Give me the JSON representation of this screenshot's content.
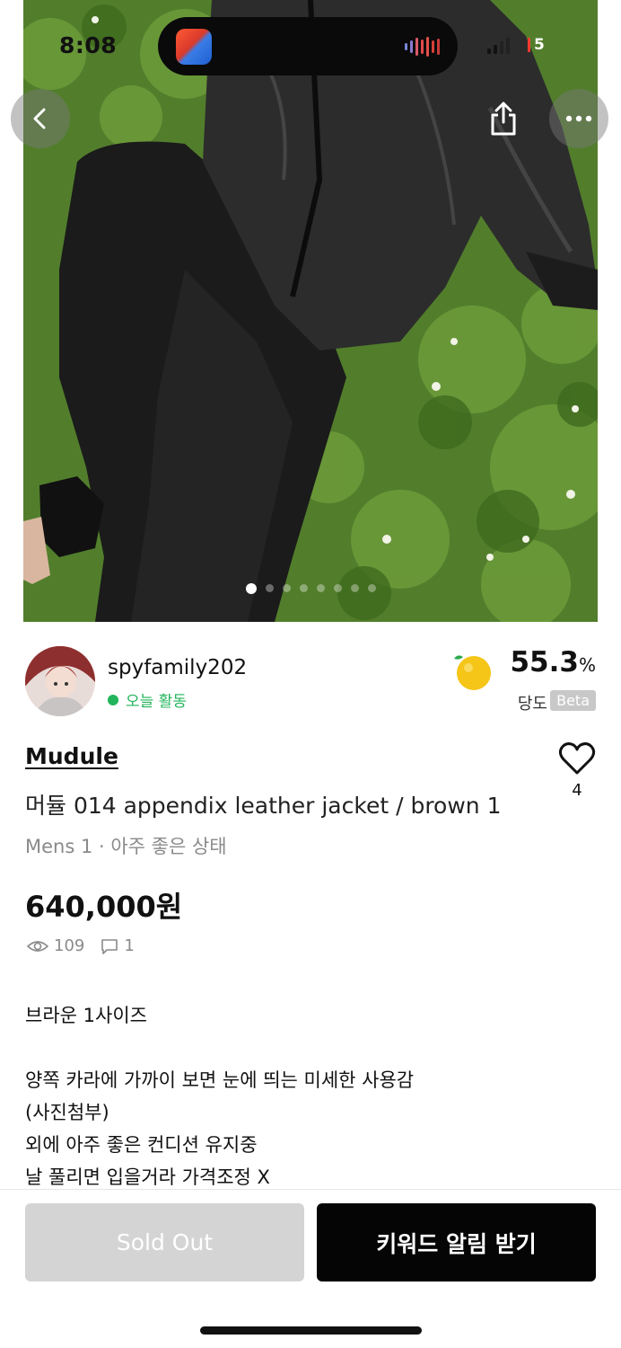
{
  "status_bar": {
    "time": "8:08",
    "battery": "5"
  },
  "nav": {
    "back_icon": "chevron-left-icon",
    "share_icon": "share-icon",
    "more_icon": "more-horizontal-icon"
  },
  "gallery": {
    "image_count": 8,
    "current_index": 1
  },
  "seller": {
    "username": "spyfamily202",
    "activity": "오늘 활동",
    "sweetness_value": "55.3",
    "sweetness_unit": "%",
    "sweetness_label": "당도",
    "beta_badge": "Beta"
  },
  "item": {
    "brand": "Mudule",
    "title": "머듈 014 appendix leather jacket / brown 1",
    "meta": "Mens 1 · 아주 좋은 상태",
    "price": "640,000원",
    "views": "109",
    "comments": "1",
    "likes": "4",
    "description": [
      "브라운 1사이즈",
      "",
      "양쪽 카라에 가까이 보면 눈에 띄는 미세한 사용감",
      "(사진첨부)",
      "외에 아주 좋은 컨디션 유지중",
      "날 풀리면 입을거라 가격조정 X"
    ]
  },
  "actions": {
    "sold_out_label": "Sold Out",
    "keyword_alert_label": "키워드 알림 받기"
  },
  "colors": {
    "accent_green": "#22b45b",
    "primary_button": "#050505",
    "disabled_button": "#d4d4d4"
  }
}
